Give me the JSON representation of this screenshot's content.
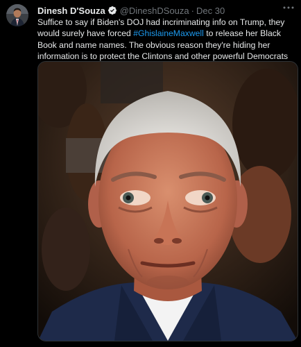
{
  "tweet": {
    "author": {
      "display_name": "Dinesh D'Souza",
      "handle": "@DineshDSouza",
      "verified_icon": "verified-badge-icon"
    },
    "separator": "·",
    "date": "Dec 30",
    "more_icon": "more-options-icon",
    "text": {
      "part1": "Suffice to say if Biden's DOJ had incriminating info on Trump, they would surely have forced ",
      "hashtag": "#GhislaineMaxwell",
      "part2": " to release her Black Book and name names. The obvious reason they're hiding her information is to protect the Clintons and other powerful Democrats and globalists"
    },
    "media": {
      "type": "photo",
      "icon": "tweet-photo"
    },
    "colors": {
      "background": "#000000",
      "text": "#e7e9ea",
      "secondary": "#71767b",
      "link": "#1d9bf0"
    }
  }
}
